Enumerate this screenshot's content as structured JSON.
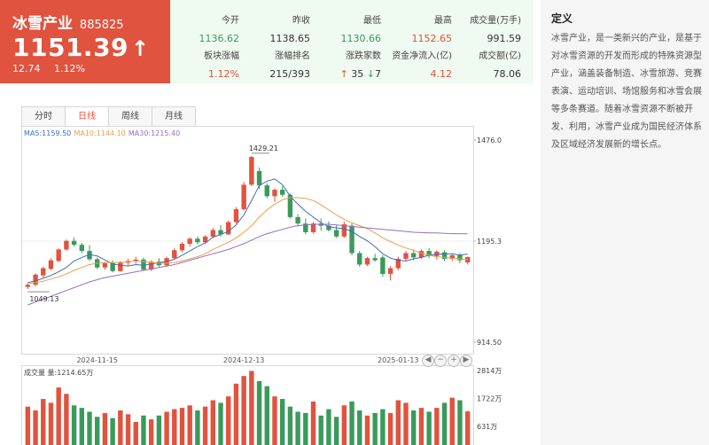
{
  "header": {
    "name": "冰雪产业",
    "code": "885825",
    "price": "1151.39",
    "change": "12.74",
    "change_pct": "1.12%"
  },
  "stats": {
    "open_label": "今开",
    "open": "1136.62",
    "prev_close_label": "昨收",
    "prev_close": "1138.65",
    "low_label": "最低",
    "low": "1130.66",
    "high_label": "最高",
    "high": "1152.65",
    "volume_label": "成交量(万手)",
    "volume": "991.59",
    "sector_change_label": "板块涨幅",
    "sector_change": "1.12%",
    "rank_label": "涨幅排名",
    "rank": "215/393",
    "updown_label": "涨跌家数",
    "up_count": "35",
    "down_count": "7",
    "netflow_label": "资金净流入(亿)",
    "netflow": "4.12",
    "turnover_label": "成交额(亿)",
    "turnover": "78.06"
  },
  "definition": {
    "title": "定义",
    "text": "冰雪产业，是一类新兴的产业，是基于对冰雪资源的开发而形成的特殊资源型产业，涵盖装备制造、冰雪旅游、竞赛表演、运动培训、场馆服务和冰雪会展等多条赛道。随着冰雪资源不断被开发、利用，冰雪产业成为国民经济体系及区域经济发展新的增长点。"
  },
  "tabs": [
    {
      "label": "分时",
      "active": false
    },
    {
      "label": "日线",
      "active": true
    },
    {
      "label": "周线",
      "active": false
    },
    {
      "label": "月线",
      "active": false
    }
  ],
  "zoom_buttons": [
    "◀",
    "−",
    "+",
    "▶"
  ],
  "colors": {
    "up": "#e0533f",
    "down": "#3a9a5b",
    "ma5": "#3b6fb6",
    "ma10": "#e8a04a",
    "ma30": "#9b6cc0"
  },
  "chart_data": {
    "type": "candlestick",
    "ma_legend": [
      {
        "label": "MA5:1159.50",
        "color": "#3b6fb6"
      },
      {
        "label": "MA10:1144.10",
        "color": "#e8a04a"
      },
      {
        "label": "MA30:1215.40",
        "color": "#9b6cc0"
      }
    ],
    "price_axis": {
      "ticks": [
        "1476.0",
        "1195.3",
        "914.50"
      ],
      "min": 914.5,
      "max": 1476.0
    },
    "date_ticks": [
      "2024-11-15",
      "2024-12-13",
      "2025-01-13"
    ],
    "annotations": {
      "max": "1429.21",
      "min": "1049.13"
    },
    "volume_label": "成交量 量:1214.65万",
    "volume_axis": {
      "ticks": [
        "2814万",
        "1722万",
        "631万"
      ],
      "max": 2814
    },
    "ohlc": [
      [
        1068,
        1078,
        1062,
        1074
      ],
      [
        1074,
        1106,
        1070,
        1102
      ],
      [
        1100,
        1124,
        1094,
        1120
      ],
      [
        1118,
        1148,
        1114,
        1142
      ],
      [
        1140,
        1175,
        1136,
        1172
      ],
      [
        1172,
        1200,
        1168,
        1196
      ],
      [
        1196,
        1206,
        1180,
        1185
      ],
      [
        1185,
        1190,
        1162,
        1168
      ],
      [
        1168,
        1184,
        1140,
        1145
      ],
      [
        1145,
        1150,
        1118,
        1122
      ],
      [
        1122,
        1138,
        1115,
        1134
      ],
      [
        1134,
        1142,
        1108,
        1112
      ],
      [
        1112,
        1140,
        1110,
        1135
      ],
      [
        1135,
        1146,
        1128,
        1140
      ],
      [
        1140,
        1152,
        1132,
        1144
      ],
      [
        1144,
        1150,
        1112,
        1116
      ],
      [
        1116,
        1142,
        1112,
        1138
      ],
      [
        1138,
        1148,
        1124,
        1128
      ],
      [
        1128,
        1152,
        1124,
        1148
      ],
      [
        1148,
        1175,
        1144,
        1170
      ],
      [
        1170,
        1192,
        1164,
        1188
      ],
      [
        1188,
        1206,
        1180,
        1202
      ],
      [
        1202,
        1208,
        1186,
        1192
      ],
      [
        1192,
        1212,
        1188,
        1208
      ],
      [
        1208,
        1232,
        1204,
        1226
      ],
      [
        1226,
        1240,
        1208,
        1214
      ],
      [
        1214,
        1252,
        1212,
        1248
      ],
      [
        1248,
        1290,
        1244,
        1284
      ],
      [
        1284,
        1360,
        1280,
        1352
      ],
      [
        1352,
        1432,
        1348,
        1429
      ],
      [
        1390,
        1400,
        1340,
        1350
      ],
      [
        1350,
        1356,
        1314,
        1320
      ],
      [
        1320,
        1342,
        1305,
        1338
      ],
      [
        1338,
        1348,
        1318,
        1324
      ],
      [
        1324,
        1328,
        1258,
        1262
      ],
      [
        1262,
        1270,
        1236,
        1244
      ],
      [
        1244,
        1258,
        1214,
        1220
      ],
      [
        1220,
        1248,
        1216,
        1244
      ],
      [
        1244,
        1258,
        1224,
        1238
      ],
      [
        1238,
        1250,
        1222,
        1226
      ],
      [
        1226,
        1240,
        1204,
        1208
      ],
      [
        1208,
        1250,
        1204,
        1242
      ],
      [
        1238,
        1244,
        1156,
        1162
      ],
      [
        1162,
        1168,
        1124,
        1130
      ],
      [
        1130,
        1152,
        1126,
        1148
      ],
      [
        1148,
        1160,
        1138,
        1142
      ],
      [
        1150,
        1156,
        1096,
        1104
      ],
      [
        1104,
        1126,
        1086,
        1120
      ],
      [
        1120,
        1152,
        1114,
        1146
      ],
      [
        1146,
        1168,
        1140,
        1162
      ],
      [
        1162,
        1172,
        1142,
        1150
      ],
      [
        1150,
        1172,
        1146,
        1168
      ],
      [
        1168,
        1176,
        1148,
        1154
      ],
      [
        1154,
        1170,
        1144,
        1166
      ],
      [
        1164,
        1170,
        1140,
        1146
      ],
      [
        1146,
        1160,
        1140,
        1156
      ],
      [
        1156,
        1162,
        1134,
        1142
      ],
      [
        1136,
        1152,
        1130,
        1151
      ]
    ],
    "ma5": [
      1080,
      1085,
      1092,
      1100,
      1110,
      1122,
      1140,
      1150,
      1158,
      1154,
      1143,
      1132,
      1128,
      1126,
      1130,
      1128,
      1132,
      1136,
      1138,
      1145,
      1156,
      1168,
      1180,
      1190,
      1206,
      1214,
      1222,
      1240,
      1268,
      1308,
      1350,
      1362,
      1368,
      1352,
      1320,
      1298,
      1278,
      1262,
      1246,
      1236,
      1232,
      1230,
      1222,
      1208,
      1196,
      1180,
      1160,
      1148,
      1142,
      1140,
      1146,
      1150,
      1156,
      1158,
      1160,
      1160,
      1156,
      1159.5
    ],
    "ma10": [
      1078,
      1080,
      1084,
      1090,
      1096,
      1104,
      1114,
      1122,
      1130,
      1134,
      1136,
      1136,
      1136,
      1138,
      1140,
      1138,
      1136,
      1134,
      1134,
      1136,
      1140,
      1146,
      1152,
      1160,
      1172,
      1182,
      1192,
      1204,
      1220,
      1238,
      1262,
      1282,
      1298,
      1310,
      1316,
      1316,
      1314,
      1308,
      1296,
      1282,
      1268,
      1256,
      1246,
      1238,
      1230,
      1218,
      1204,
      1194,
      1184,
      1176,
      1170,
      1162,
      1156,
      1152,
      1150,
      1148,
      1146,
      1144.1
    ],
    "ma30": [
      1018,
      1026,
      1034,
      1042,
      1050,
      1058,
      1066,
      1074,
      1082,
      1088,
      1094,
      1098,
      1102,
      1106,
      1110,
      1114,
      1118,
      1122,
      1126,
      1130,
      1136,
      1142,
      1148,
      1154,
      1160,
      1166,
      1172,
      1180,
      1188,
      1198,
      1208,
      1216,
      1222,
      1228,
      1234,
      1238,
      1240,
      1242,
      1242,
      1242,
      1240,
      1238,
      1236,
      1234,
      1232,
      1230,
      1228,
      1226,
      1224,
      1222,
      1220,
      1219,
      1218,
      1218,
      1217,
      1216,
      1216,
      1215.4
    ],
    "volume": [
      1400,
      1250,
      1700,
      1550,
      2150,
      1900,
      1450,
      1350,
      1200,
      1000,
      1150,
      950,
      1250,
      1100,
      800,
      1050,
      900,
      1050,
      1200,
      1300,
      1350,
      1450,
      1250,
      1400,
      1650,
      1550,
      1800,
      2300,
      2600,
      2800,
      2400,
      2200,
      1800,
      1700,
      1400,
      1200,
      1150,
      1600,
      1050,
      1300,
      1000,
      1450,
      1600,
      1250,
      1050,
      1150,
      1300,
      1150,
      1650,
      1550,
      1250,
      1350,
      1200,
      1350,
      1550,
      1750,
      1650,
      1215
    ]
  }
}
